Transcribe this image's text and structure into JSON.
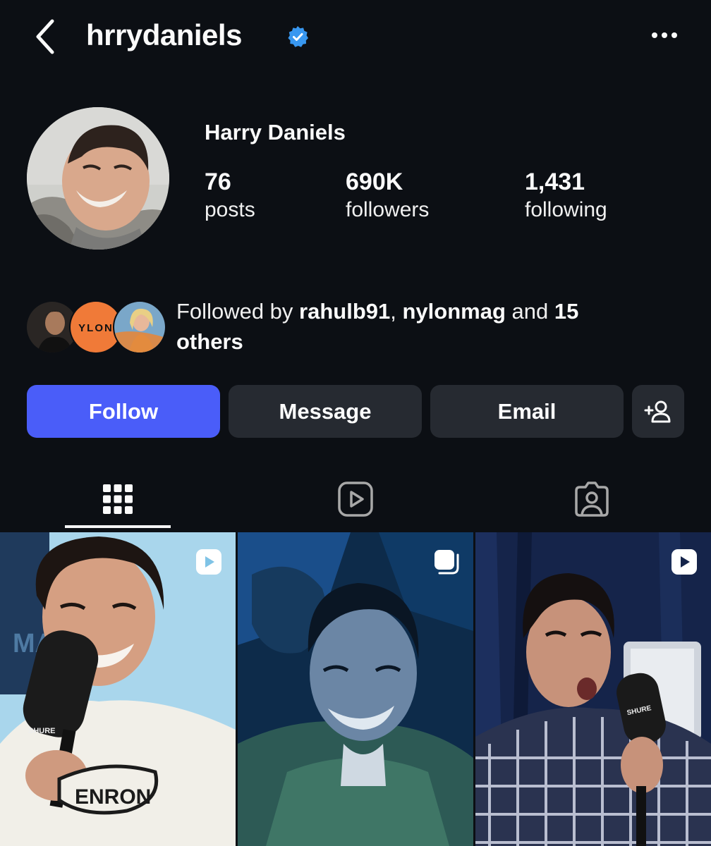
{
  "header": {
    "username": "hrrydaniels",
    "verified_icon": "verified-badge-icon",
    "back_icon": "chevron-left-icon",
    "more_icon": "more-horizontal-icon"
  },
  "profile": {
    "display_name": "Harry Daniels",
    "stats": {
      "posts_count": "76",
      "posts_label": "posts",
      "followers_count": "690K",
      "followers_label": "followers",
      "following_count": "1,431",
      "following_label": "following"
    }
  },
  "followed_by": {
    "prefix": "Followed by ",
    "user1": "rahulb91",
    "separator": ", ",
    "user2": "nylonmag",
    "middle": " and ",
    "count": "15",
    "suffix": "others",
    "avatar_text": "YLON"
  },
  "actions": {
    "follow_label": "Follow",
    "message_label": "Message",
    "email_label": "Email",
    "suggest_icon": "add-person-icon"
  },
  "tabs": [
    {
      "name": "posts-grid",
      "icon": "grid-icon",
      "active": true
    },
    {
      "name": "reels",
      "icon": "reels-icon",
      "active": false
    },
    {
      "name": "tagged",
      "icon": "tagged-person-icon",
      "active": false
    }
  ],
  "grid_posts": [
    {
      "type": "reel",
      "badge_icon": "reel-play-icon",
      "shirt_text": "ENRON",
      "mic_text": "SHURE",
      "sign_text": "MAL"
    },
    {
      "type": "carousel",
      "badge_icon": "carousel-icon"
    },
    {
      "type": "reel",
      "badge_icon": "reel-play-icon",
      "mic_text": "SHURE"
    }
  ],
  "colors": {
    "background": "#0c0f14",
    "follow_button": "#4a5df9",
    "secondary_button": "#262a31",
    "verified": "#3897f0"
  }
}
